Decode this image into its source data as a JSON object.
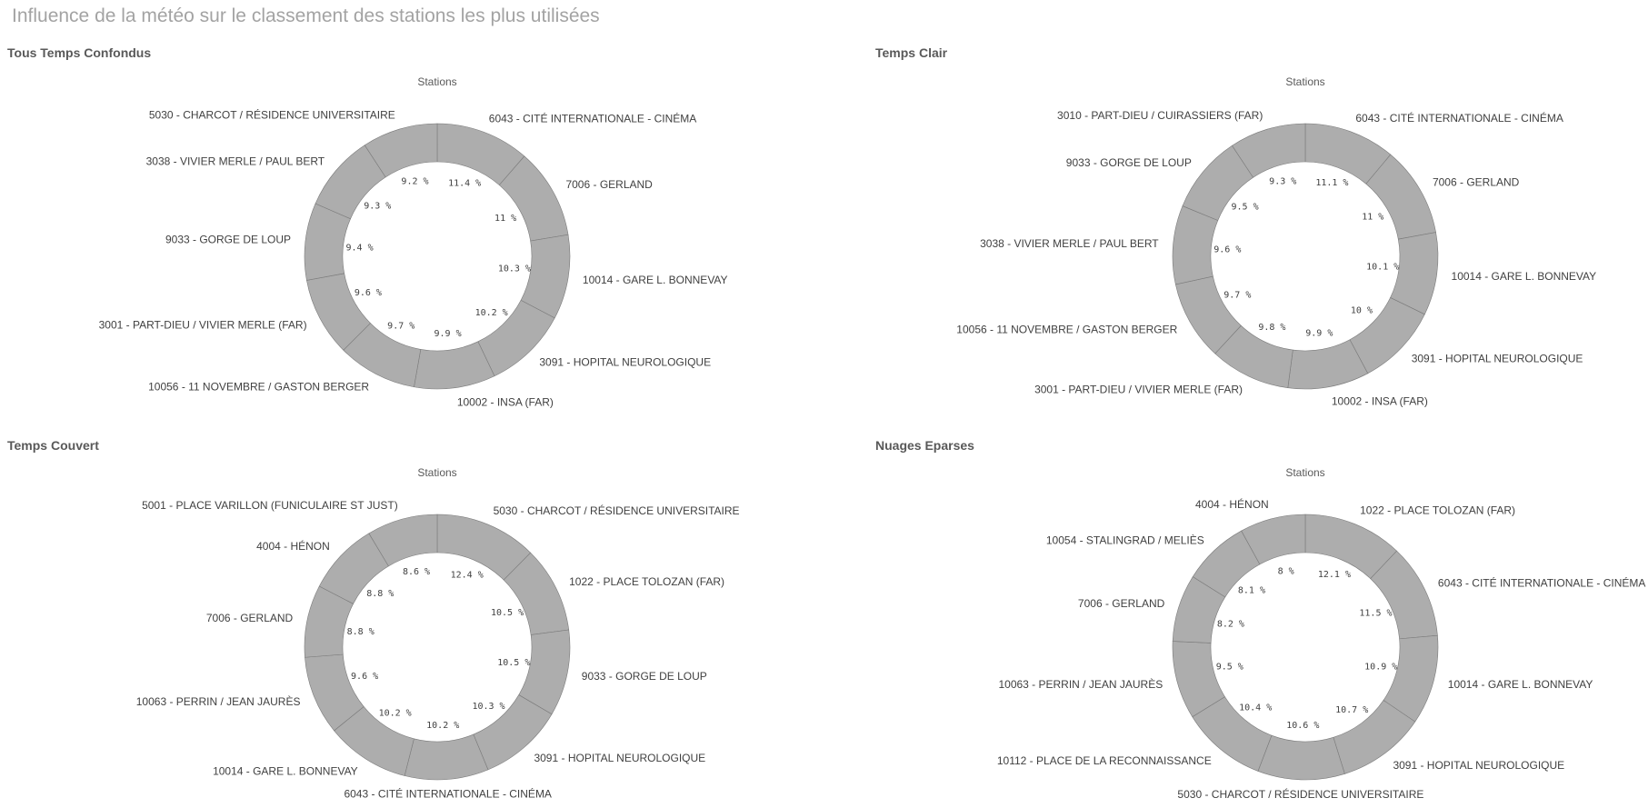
{
  "page": {
    "title": "Influence de la météo sur le classement des stations les plus utilisées"
  },
  "colors": {
    "slice": "#adadad",
    "slice_border": "#7a7a7a",
    "text": "#404040",
    "title": "#a3a3a3"
  },
  "chart_data": [
    {
      "type": "pie",
      "title": "Tous Temps Confondus",
      "dimension_label": "Stations",
      "donut": true,
      "categories": [
        "6043 - CITÉ INTERNATIONALE - CINÉMA",
        "7006 - GERLAND",
        "10014 - GARE L. BONNEVAY",
        "3091 - HOPITAL NEUROLOGIQUE",
        "10002 - INSA (FAR)",
        "10056 - 11 NOVEMBRE / GASTON BERGER",
        "3001 - PART-DIEU / VIVIER MERLE (FAR)",
        "9033 - GORGE DE LOUP",
        "3038 - VIVIER MERLE / PAUL BERT",
        "5030 - CHARCOT / RÉSIDENCE UNIVERSITAIRE"
      ],
      "values": [
        11.4,
        11,
        10.3,
        10.2,
        9.9,
        9.7,
        9.6,
        9.4,
        9.3,
        9.2
      ],
      "value_labels": [
        "11.4 %",
        "11 %",
        "10.3 %",
        "10.2 %",
        "9.9 %",
        "9.7 %",
        "9.6 %",
        "9.4 %",
        "9.3 %",
        "9.2 %"
      ]
    },
    {
      "type": "pie",
      "title": "Temps Clair",
      "dimension_label": "Stations",
      "donut": true,
      "categories": [
        "6043 - CITÉ INTERNATIONALE - CINÉMA",
        "7006 - GERLAND",
        "10014 - GARE L. BONNEVAY",
        "3091 - HOPITAL NEUROLOGIQUE",
        "10002 - INSA (FAR)",
        "3001 - PART-DIEU / VIVIER MERLE (FAR)",
        "10056 - 11 NOVEMBRE / GASTON BERGER",
        "3038 - VIVIER MERLE / PAUL BERT",
        "9033 - GORGE DE LOUP",
        "3010 - PART-DIEU / CUIRASSIERS (FAR)"
      ],
      "values": [
        11.1,
        11,
        10.1,
        10,
        9.9,
        9.8,
        9.7,
        9.6,
        9.5,
        9.3
      ],
      "value_labels": [
        "11.1 %",
        "11 %",
        "10.1 %",
        "10 %",
        "9.9 %",
        "9.8 %",
        "9.7 %",
        "9.6 %",
        "9.5 %",
        "9.3 %"
      ]
    },
    {
      "type": "pie",
      "title": "Temps Couvert",
      "dimension_label": "Stations",
      "donut": true,
      "categories": [
        "5030 - CHARCOT / RÉSIDENCE UNIVERSITAIRE",
        "1022 - PLACE TOLOZAN (FAR)",
        "9033 - GORGE DE LOUP",
        "3091 - HOPITAL NEUROLOGIQUE",
        "6043 - CITÉ INTERNATIONALE - CINÉMA",
        "10014 - GARE L. BONNEVAY",
        "10063 - PERRIN / JEAN JAURÈS",
        "7006 - GERLAND",
        "4004 - HÉNON",
        "5001 - PLACE VARILLON (FUNICULAIRE ST JUST)"
      ],
      "values": [
        12.4,
        10.5,
        10.5,
        10.3,
        10.2,
        10.2,
        9.6,
        8.8,
        8.8,
        8.6
      ],
      "value_labels": [
        "12.4 %",
        "10.5 %",
        "10.5 %",
        "10.3 %",
        "10.2 %",
        "10.2 %",
        "9.6 %",
        "8.8 %",
        "8.8 %",
        "8.6 %"
      ]
    },
    {
      "type": "pie",
      "title": "Nuages Eparses",
      "dimension_label": "Stations",
      "donut": true,
      "categories": [
        "1022 - PLACE TOLOZAN (FAR)",
        "6043 - CITÉ INTERNATIONALE - CINÉMA",
        "10014 - GARE L. BONNEVAY",
        "3091 - HOPITAL NEUROLOGIQUE",
        "5030 - CHARCOT / RÉSIDENCE UNIVERSITAIRE",
        "10112 - PLACE DE LA RECONNAISSANCE",
        "10063 - PERRIN / JEAN JAURÈS",
        "7006 - GERLAND",
        "10054 - STALINGRAD / MELIÈS",
        "4004 - HÉNON"
      ],
      "values": [
        12.1,
        11.5,
        10.9,
        10.7,
        10.6,
        10.4,
        9.5,
        8.2,
        8.1,
        8
      ],
      "value_labels": [
        "12.1 %",
        "11.5 %",
        "10.9 %",
        "10.7 %",
        "10.6 %",
        "10.4 %",
        "9.5 %",
        "8.2 %",
        "8.1 %",
        "8 %"
      ]
    }
  ]
}
